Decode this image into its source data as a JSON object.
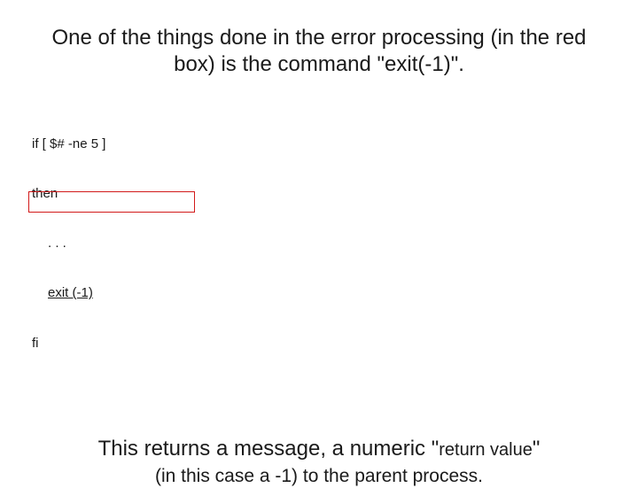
{
  "para1": "One of the things done in the error processing (in the red box) is the command \"exit(-1)\".",
  "code": {
    "l1": "if [ $# -ne 5 ]",
    "l2": "then",
    "l3": ". . .",
    "l4": "exit (-1)",
    "l5": "fi"
  },
  "para2": {
    "line1_a": "This returns a message, a numeric \"",
    "line1_b": "return value",
    "line1_c": "\"",
    "line2": "(in this case a -1) to the parent process."
  }
}
